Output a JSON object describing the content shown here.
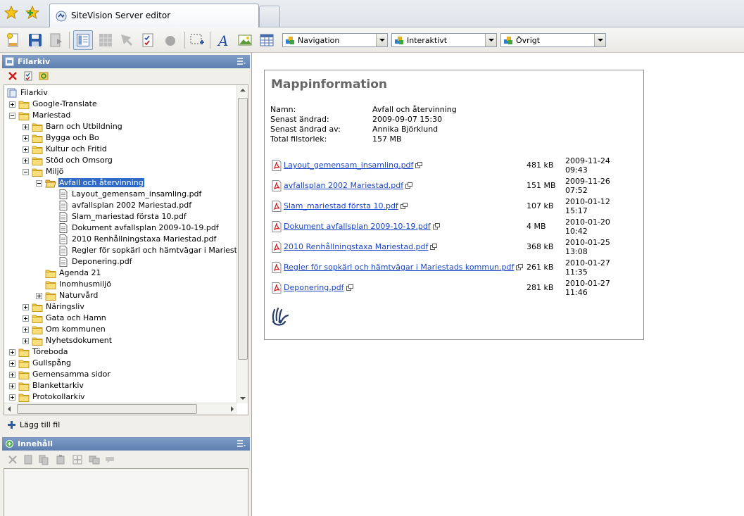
{
  "browser": {
    "tab_title": "SiteVision Server editor"
  },
  "toolbar": {
    "dropdowns": [
      {
        "label": "Navigation"
      },
      {
        "label": "Interaktivt"
      },
      {
        "label": "Övrigt"
      }
    ]
  },
  "filarkiv_panel": {
    "title": "Filarkiv",
    "tree": [
      {
        "label": "Filarkiv",
        "type": "root",
        "level": 0
      },
      {
        "label": "Google-Translate",
        "type": "folder",
        "level": 1,
        "expander": "plus"
      },
      {
        "label": "Mariestad",
        "type": "folder",
        "level": 1,
        "expander": "minus"
      },
      {
        "label": "Barn och Utbildning",
        "type": "folder",
        "level": 2,
        "expander": "plus"
      },
      {
        "label": "Bygga och Bo",
        "type": "folder",
        "level": 2,
        "expander": "plus"
      },
      {
        "label": "Kultur och Fritid",
        "type": "folder",
        "level": 2,
        "expander": "plus"
      },
      {
        "label": "Stöd och Omsorg",
        "type": "folder",
        "level": 2,
        "expander": "plus"
      },
      {
        "label": "Miljö",
        "type": "folder",
        "level": 2,
        "expander": "minus"
      },
      {
        "label": "Avfall och återvinning",
        "type": "folder-open",
        "level": 3,
        "expander": "minus",
        "selected": true
      },
      {
        "label": "Layout_gemensam_insamling.pdf",
        "type": "file",
        "level": 4
      },
      {
        "label": "avfallsplan 2002 Mariestad.pdf",
        "type": "file",
        "level": 4
      },
      {
        "label": "Slam_mariestad första 10.pdf",
        "type": "file",
        "level": 4
      },
      {
        "label": "Dokument avfallsplan 2009-10-19.pdf",
        "type": "file",
        "level": 4
      },
      {
        "label": "2010 Renhållningstaxa Mariestad.pdf",
        "type": "file",
        "level": 4
      },
      {
        "label": "Regler för sopkärl och hämtvägar i Mariestads ko",
        "type": "file",
        "level": 4
      },
      {
        "label": "Deponering.pdf",
        "type": "file",
        "level": 4
      },
      {
        "label": "Agenda 21",
        "type": "folder",
        "level": 3
      },
      {
        "label": "Inomhusmiljö",
        "type": "folder",
        "level": 3
      },
      {
        "label": "Naturvård",
        "type": "folder",
        "level": 3,
        "expander": "plus"
      },
      {
        "label": "Näringsliv",
        "type": "folder",
        "level": 2,
        "expander": "plus"
      },
      {
        "label": "Gata och Hamn",
        "type": "folder",
        "level": 2,
        "expander": "plus"
      },
      {
        "label": "Om kommunen",
        "type": "folder",
        "level": 2,
        "expander": "plus"
      },
      {
        "label": "Nyhetsdokument",
        "type": "folder",
        "level": 2,
        "expander": "plus"
      },
      {
        "label": "Töreboda",
        "type": "folder",
        "level": 1,
        "expander": "plus"
      },
      {
        "label": "Gullspång",
        "type": "folder",
        "level": 1,
        "expander": "plus"
      },
      {
        "label": "Gemensamma sidor",
        "type": "folder",
        "level": 1,
        "expander": "plus"
      },
      {
        "label": "Blankettarkiv",
        "type": "folder",
        "level": 1,
        "expander": "plus"
      },
      {
        "label": "Protokollarkiv",
        "type": "folder",
        "level": 1,
        "expander": "plus"
      }
    ],
    "add_file_label": "Lägg till fil"
  },
  "content_panel": {
    "title": "Innehåll"
  },
  "folder_info": {
    "title": "Mappinformation",
    "meta": [
      {
        "label": "Namn:",
        "value": "Avfall och återvinning"
      },
      {
        "label": "Senast ändrad:",
        "value": "2009-09-07 15:30"
      },
      {
        "label": "Senast ändrad av:",
        "value": "Annika Björklund"
      },
      {
        "label": "Total filstorlek:",
        "value": "157 MB"
      }
    ],
    "files": [
      {
        "name": "Layout_gemensam_insamling.pdf",
        "size": "481 kB",
        "date": "2009-11-24",
        "time": "09:43"
      },
      {
        "name": "avfallsplan 2002 Mariestad.pdf",
        "size": "151 MB",
        "date": "2009-11-26",
        "time": "07:52"
      },
      {
        "name": "Slam_mariestad första 10.pdf",
        "size": "107 kB",
        "date": "2010-01-12",
        "time": "15:17"
      },
      {
        "name": "Dokument avfallsplan 2009-10-19.pdf",
        "size": "4 MB",
        "date": "2010-01-20",
        "time": "10:42"
      },
      {
        "name": "2010 Renhållningstaxa Mariestad.pdf",
        "size": "368 kB",
        "date": "2010-01-25",
        "time": "13:08"
      },
      {
        "name": "Regler för sopkärl och hämtvägar i Mariestads kommun.pdf",
        "size": "261 kB",
        "date": "2010-01-27",
        "time": "11:35"
      },
      {
        "name": "Deponering.pdf",
        "size": "281 kB",
        "date": "2010-01-27",
        "time": "11:46"
      }
    ]
  }
}
